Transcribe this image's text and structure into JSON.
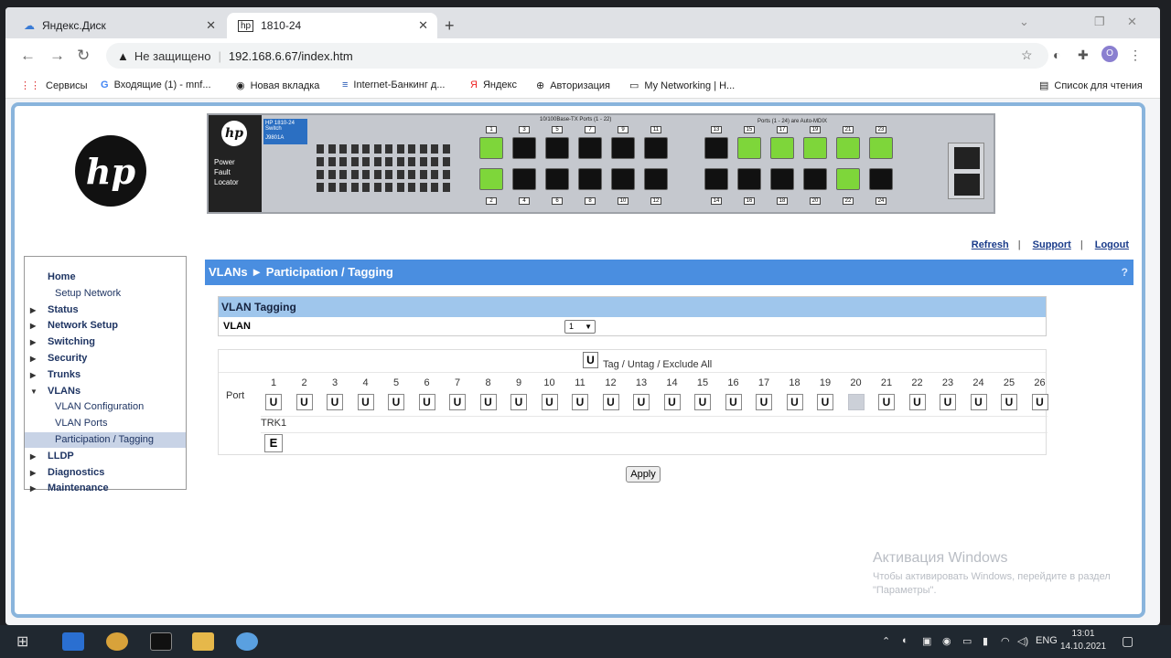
{
  "browser": {
    "tabs": [
      {
        "label": "Яндекс.Диск"
      },
      {
        "label": "1810-24"
      }
    ],
    "security_label": "Не защищено",
    "url": "192.168.6.67/index.htm",
    "bookmarks": [
      {
        "label": "Сервисы",
        "icon": "apps-icon"
      },
      {
        "label": "Входящие (1) - mnf...",
        "icon": "google-icon"
      },
      {
        "label": "Новая вкладка",
        "icon": "globe-icon"
      },
      {
        "label": "Internet-Банкинг д...",
        "icon": "bank-icon"
      },
      {
        "label": "Яндекс",
        "icon": "yandex-icon"
      },
      {
        "label": "Авторизация",
        "icon": "login-icon"
      },
      {
        "label": "My Networking | H...",
        "icon": "page-icon"
      }
    ],
    "reading_list": "Список для чтения",
    "profile_initial": "О"
  },
  "switch_panel": {
    "model": "HP 1810-24 Switch",
    "part": "J9801A",
    "port_header_left": "10/100Base-TX Ports (1 - 22)",
    "port_header_right": "Ports (1 - 24) are Auto-MDIX",
    "top_ports": [
      1,
      3,
      5,
      7,
      9,
      11,
      13,
      15,
      17,
      19,
      21,
      23
    ],
    "bottom_ports": [
      2,
      4,
      6,
      8,
      10,
      12,
      14,
      16,
      18,
      20,
      22,
      24
    ],
    "active_top": [
      1,
      15,
      17,
      19,
      21,
      23
    ],
    "active_bottom": [
      2,
      22
    ]
  },
  "header_links": [
    "Refresh",
    "Support",
    "Logout"
  ],
  "nav": [
    {
      "label": "Home",
      "level": 0,
      "arrow": false,
      "selected": false
    },
    {
      "label": "Setup Network",
      "level": 1,
      "arrow": false,
      "selected": false
    },
    {
      "label": "Status",
      "level": 0,
      "arrow": true,
      "selected": false
    },
    {
      "label": "Network Setup",
      "level": 0,
      "arrow": true,
      "selected": false
    },
    {
      "label": "Switching",
      "level": 0,
      "arrow": true,
      "selected": false
    },
    {
      "label": "Security",
      "level": 0,
      "arrow": true,
      "selected": false
    },
    {
      "label": "Trunks",
      "level": 0,
      "arrow": true,
      "selected": false
    },
    {
      "label": "VLANs",
      "level": 0,
      "arrow": "down",
      "selected": false
    },
    {
      "label": "VLAN Configuration",
      "level": 1,
      "arrow": false,
      "selected": false
    },
    {
      "label": "VLAN Ports",
      "level": 1,
      "arrow": false,
      "selected": false
    },
    {
      "label": "Participation / Tagging",
      "level": 1,
      "arrow": false,
      "selected": true
    },
    {
      "label": "LLDP",
      "level": 0,
      "arrow": true,
      "selected": false
    },
    {
      "label": "Diagnostics",
      "level": 0,
      "arrow": true,
      "selected": false
    },
    {
      "label": "Maintenance",
      "level": 0,
      "arrow": true,
      "selected": false
    }
  ],
  "breadcrumb": "VLANs ► Participation / Tagging",
  "vlan_tagging": {
    "title": "VLAN Tagging",
    "vlan_label": "VLAN",
    "vlan_value": "1",
    "all_button": "U",
    "all_label": "Tag / Untag / Exclude All",
    "port_label": "Port",
    "ports": [
      "1",
      "2",
      "3",
      "4",
      "5",
      "6",
      "7",
      "8",
      "9",
      "10",
      "11",
      "12",
      "13",
      "14",
      "15",
      "16",
      "17",
      "18",
      "19",
      "20",
      "21",
      "22",
      "23",
      "24",
      "25",
      "26"
    ],
    "states": [
      "U",
      "U",
      "U",
      "U",
      "U",
      "U",
      "U",
      "U",
      "U",
      "U",
      "U",
      "U",
      "U",
      "U",
      "U",
      "U",
      "U",
      "U",
      "U",
      "",
      "U",
      "U",
      "U",
      "U",
      "U",
      "U"
    ],
    "trunk_label": "TRK1",
    "trunk_state": "E",
    "apply": "Apply"
  },
  "windows_activation": {
    "title": "Активация Windows",
    "text": "Чтобы активировать Windows, перейдите в раздел \"Параметры\"."
  },
  "taskbar": {
    "lang": "ENG",
    "time": "13:01",
    "date": "14.10.2021"
  }
}
